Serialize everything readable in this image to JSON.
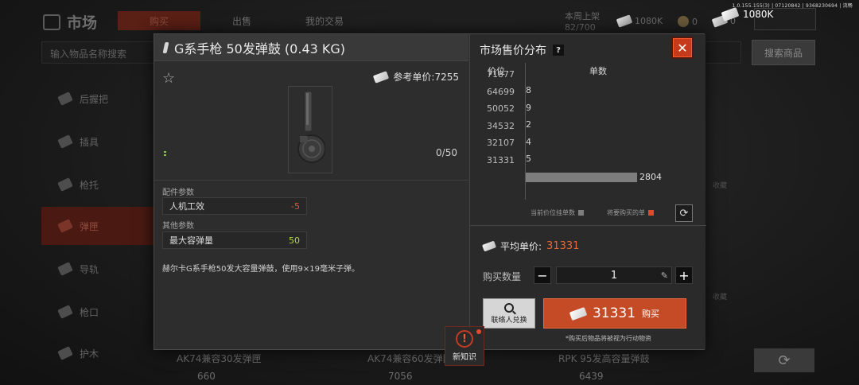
{
  "background": {
    "title": "市场",
    "tabs": [
      "购买",
      "出售",
      "我的交易"
    ],
    "weekly_label": "本周上架",
    "weekly_value": "82/700",
    "currency_amount": "1080K",
    "coin_a": "0",
    "coin_b": "0",
    "search_placeholder": "输入物品名称搜索",
    "search_button": "搜索商品",
    "sidebar": [
      "后握把",
      "插具",
      "枪托",
      "弹匣",
      "导轨",
      "枪口",
      "护木"
    ],
    "bottom_items": [
      "AK74兼容30发弹匣",
      "AK74兼容60发弹匣",
      "RPK 95发高容量弹鼓"
    ],
    "bottom_prices": [
      "660",
      "7056",
      "6439"
    ],
    "collect_label": "收藏"
  },
  "version": "1.0.155.155(3) | 07120842 | 9368230694 | 流畅",
  "top_balance": "1080K",
  "dialog": {
    "title": "G系手枪 50发弹鼓 (0.43 KG)",
    "ref_price": "参考单价:7255",
    "count": "0/50",
    "section_attach": "配件参数",
    "param_ergo_label": "人机工效",
    "param_ergo_value": "-5",
    "section_other": "其他参数",
    "param_cap_label": "最大容弹量",
    "param_cap_value": "50",
    "description": "赫尔卡G系手枪50发大容量弹鼓，使用9×19毫米子弹。"
  },
  "market": {
    "title": "市场售价分布",
    "help": "?",
    "col_price": "价位",
    "col_qty": "单数",
    "legend_current": "当前价位挂单数",
    "legend_buy": "将要购买的单",
    "avg_label": "平均单价:",
    "avg_value": "31331",
    "qty_label": "购买数量",
    "qty_value": "1",
    "contact_label": "联络人兑换",
    "buy_price": "31331",
    "buy_label": "购买",
    "buy_note": "*购买后物品将被视为行动物资"
  },
  "chart_data": {
    "type": "bar",
    "orientation": "horizontal",
    "categories": [
      "71877",
      "64699",
      "50052",
      "34532",
      "32107",
      "31331"
    ],
    "values": [
      null,
      8,
      9,
      2,
      4,
      5,
      2804
    ],
    "series": [
      {
        "name": "当前价位挂单数",
        "color": "#7e7e7e"
      },
      {
        "name": "将要购买的单",
        "color": "#e14a24"
      }
    ],
    "row_values": [
      8,
      9,
      2,
      4,
      5,
      2804
    ],
    "xlabel": "单数",
    "ylabel": "价位"
  },
  "new_knowledge": "新知识"
}
